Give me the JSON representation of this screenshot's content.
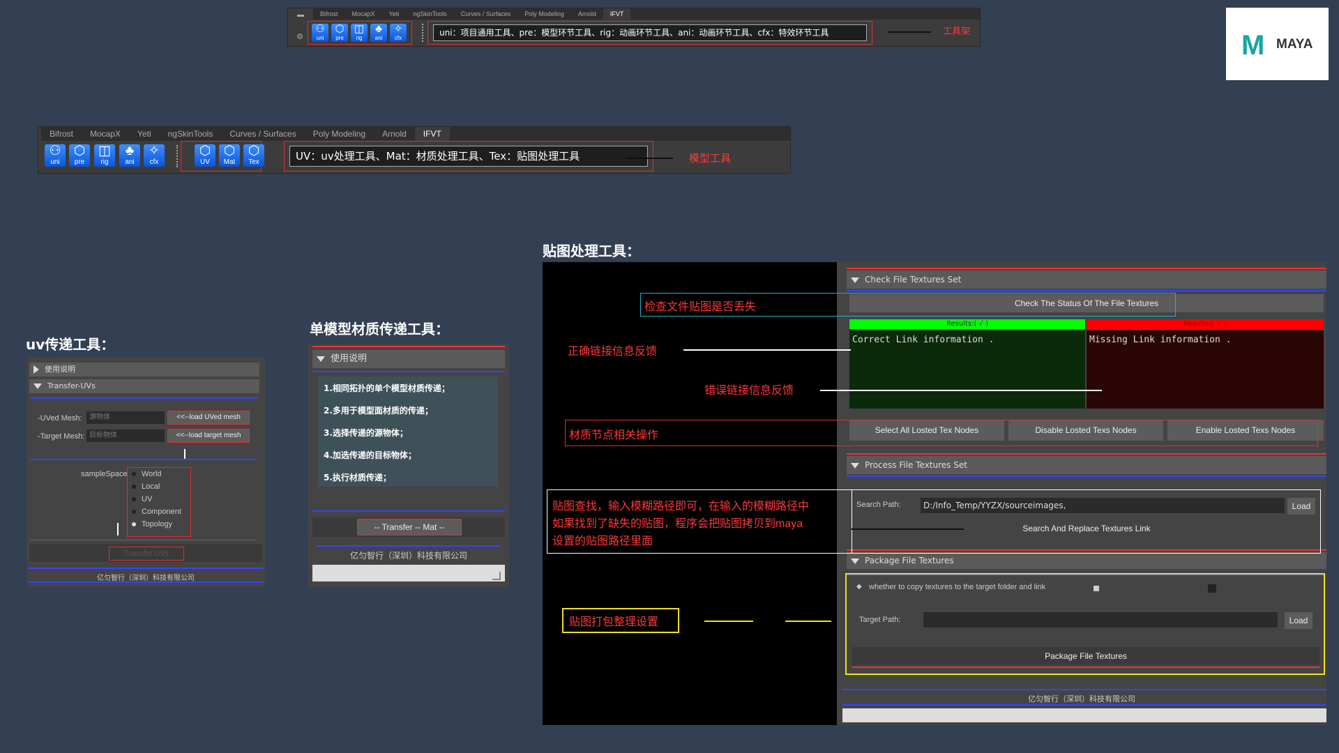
{
  "shelf_top": {
    "tabs": [
      "Bifrost",
      "MocapX",
      "Yeti",
      "ngSkinTools",
      "Curves / Surfaces",
      "Poly Modeling",
      "Arnold",
      "IFVT"
    ],
    "icons": [
      "uni",
      "pre",
      "rig",
      "ani",
      "cfx"
    ],
    "desc": "uni：项目通用工具、pre：模型环节工具、rig：动画环节工具、ani：动画环节工具、cfx：特效环节工具",
    "note": "工具架"
  },
  "shelf_model": {
    "tabs": [
      "Bifrost",
      "MocapX",
      "Yeti",
      "ngSkinTools",
      "Curves / Surfaces",
      "Poly Modeling",
      "Arnold",
      "IFVT"
    ],
    "icons": [
      "uni",
      "pre",
      "rig",
      "ani",
      "cfx"
    ],
    "model_icons": [
      "UV",
      "Mat",
      "Tex"
    ],
    "desc": "UV：uv处理工具、Mat：材质处理工具、Tex：贴图处理工具",
    "note": "模型工具"
  },
  "logo": {
    "text": "MAYA"
  },
  "uv_tool": {
    "heading": "uv传递工具：",
    "section_help": "使用说明",
    "section_transfer": "Transfer-UVs",
    "uved_label": "-UVed Mesh:",
    "uved_placeholder": "源物体",
    "uved_btn": "<<--load UVed mesh",
    "target_label": "-Target Mesh:",
    "target_placeholder": "目标物体",
    "target_btn": "<<--load target mesh",
    "sample_label": "sampleSpace",
    "options": [
      "World",
      "Local",
      "UV",
      "Component",
      "Topology"
    ],
    "selected": "Topology",
    "transfer_btn": "Transfer UVs",
    "footer": "亿匀智行（深圳）科技有限公司"
  },
  "mat_tool": {
    "heading": "单模型材质传递工具：",
    "section_help": "使用说明",
    "steps": [
      "1.相同拓扑的单个模型材质传递；",
      "2.多用于模型面材质的传递；",
      "3.选择传递的源物体；",
      "4.加选传递的目标物体；",
      "5.执行材质传递；"
    ],
    "transfer_btn": "-- Transfer -- Mat --",
    "footer": "亿匀智行（深圳）科技有限公司"
  },
  "tex_tool": {
    "heading": "贴图处理工具：",
    "check_section": "Check File Textures Set",
    "check_btn": "Check The Status Of The File Textures",
    "results_ok": "Results:( √ )",
    "results_bad": "Results:( × )",
    "correct_text": "Correct Link information .",
    "missing_text": "Missing Link information .",
    "btn_select": "Select All Losted Tex Nodes",
    "btn_disable": "Disable Losted Texs Nodes",
    "btn_enable": "Enable Losted Texs Nodes",
    "process_section": "Process File Textures Set",
    "search_label": "Search Path:",
    "search_value": "D:/Info_Temp/YYZX/sourceimages,",
    "load_btn": "Load",
    "replace_btn": "Search And Replace Textures Link",
    "package_section": "Package File Textures",
    "copy_label": "whether to copy textures to the target folder and link",
    "target_label": "Target Path:",
    "target_load": "Load",
    "package_btn": "Package File Textures",
    "footer": "亿匀智行（深圳）科技有限公司",
    "notes": {
      "check": "检查文件贴图是否丢失",
      "correct": "正确链接信息反馈",
      "error": "错误链接信息反馈",
      "nodes": "材质节点相关操作",
      "search": [
        "贴图查找，输入模糊路径即可，在输入的模糊路径中",
        "如果找到了缺失的贴图，程序会把贴图拷贝到maya",
        "设置的贴图路径里面"
      ],
      "package": "贴图打包整理设置"
    }
  }
}
